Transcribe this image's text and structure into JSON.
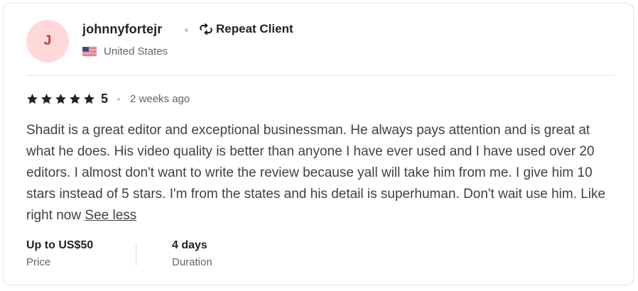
{
  "reviewer": {
    "avatar_initial": "J",
    "username": "johnnyfortejr",
    "badge": "Repeat Client",
    "country": "United States"
  },
  "rating": {
    "value": "5",
    "stars": 5,
    "max_stars": 5,
    "time_ago": "2 weeks ago"
  },
  "review": {
    "text": "Shadit is a great editor and exceptional businessman. He always pays attention and is great at what he does. His video quality is better than anyone I have ever used and I have used over 20 editors. I almost don't want to write the review because yall will take him from me. I give him 10 stars instead of 5 stars. I'm from the states and his detail is superhuman. Don't wait use him. Like right now",
    "toggle_label": "See less"
  },
  "details": [
    {
      "value": "Up to US$50",
      "label": "Price"
    },
    {
      "value": "4 days",
      "label": "Duration"
    }
  ],
  "colors": {
    "avatar_bg": "#ffd9d9",
    "avatar_text": "#c43b3b",
    "text_dark": "#222325",
    "text_muted": "#62646a",
    "border": "#e4e5e7"
  },
  "icons": {
    "badge": "repeat-icon",
    "country": "us-flag-icon",
    "rating": "star-icon"
  }
}
